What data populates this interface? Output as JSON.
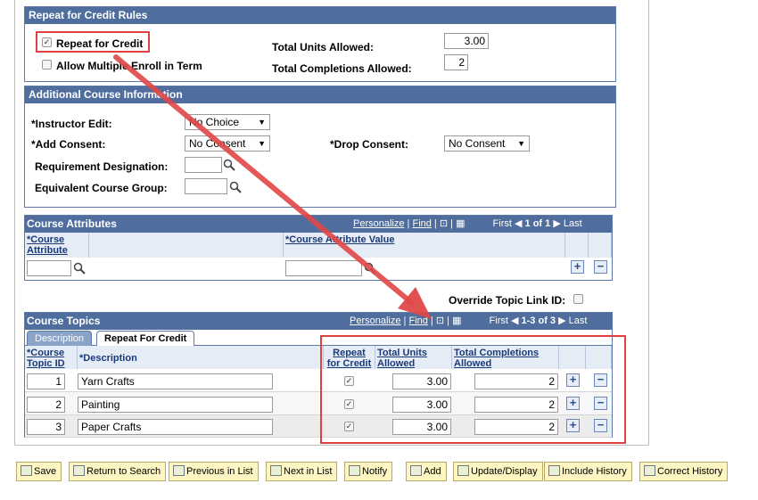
{
  "repeat_section": {
    "title": "Repeat for Credit Rules",
    "repeat_for_credit_label": "Repeat for Credit",
    "repeat_for_credit_checked": true,
    "allow_multiple_label": "Allow Multiple Enroll in Term",
    "allow_multiple_checked": false,
    "total_units_label": "Total Units Allowed:",
    "total_units_value": "3.00",
    "total_completions_label": "Total Completions Allowed:",
    "total_completions_value": "2"
  },
  "additional_section": {
    "title": "Additional Course Information",
    "instructor_edit_label": "*Instructor Edit:",
    "instructor_edit_value": "No Choice",
    "add_consent_label": "*Add Consent:",
    "add_consent_value": "No Consent",
    "drop_consent_label": "*Drop Consent:",
    "drop_consent_value": "No Consent",
    "requirement_label": "Requirement Designation:",
    "equivalent_label": "Equivalent Course Group:"
  },
  "attributes_grid": {
    "title": "Course Attributes",
    "personalize": "Personalize",
    "find": "Find",
    "first": "First",
    "range": "1 of 1",
    "last": "Last",
    "col_attribute": "*Course Attribute",
    "col_value": "*Course Attribute Value"
  },
  "override_label": "Override Topic Link ID:",
  "topics_grid": {
    "title": "Course Topics",
    "personalize": "Personalize",
    "find": "Find",
    "first": "First",
    "range": "1-3 of 3",
    "last": "Last",
    "tab_description": "Description",
    "tab_repeat": "Repeat For Credit",
    "col_topic_id": "*Course Topic ID",
    "col_description": "*Description",
    "col_repeat": "Repeat for Credit",
    "col_units": "Total Units Allowed",
    "col_completions": "Total Completions Allowed",
    "rows": [
      {
        "id": "1",
        "description": "Yarn Crafts",
        "repeat": true,
        "units": "3.00",
        "completions": "2"
      },
      {
        "id": "2",
        "description": "Painting",
        "repeat": true,
        "units": "3.00",
        "completions": "2"
      },
      {
        "id": "3",
        "description": "Paper Crafts",
        "repeat": true,
        "units": "3.00",
        "completions": "2"
      }
    ]
  },
  "toolbar": {
    "save": "Save",
    "return_to_search": "Return to Search",
    "previous_in_list": "Previous in List",
    "next_in_list": "Next in List",
    "notify": "Notify",
    "add": "Add",
    "update_display": "Update/Display",
    "include_history": "Include History",
    "correct_history": "Correct History"
  },
  "colors": {
    "header_blue": "#4f6e9e",
    "annotation_red": "#e04040",
    "button_yellow": "#fdf6c3"
  }
}
